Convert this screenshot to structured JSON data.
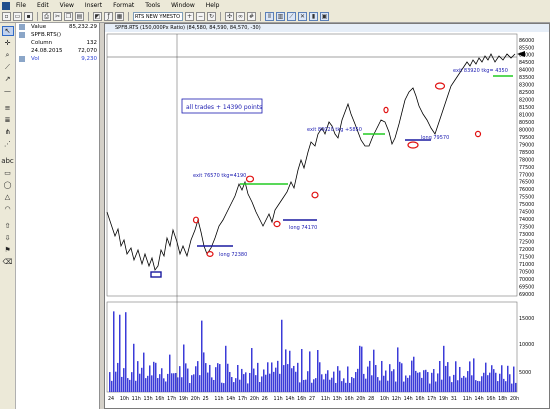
{
  "menu": [
    "File",
    "Edit",
    "View",
    "Insert",
    "Format",
    "Tools",
    "Window",
    "Help"
  ],
  "toolbar": {
    "symbol_select": "RTS NEW YMESTO CROSS",
    "chart_buttons": [
      "bar-chart-icon",
      "candle-chart-icon",
      "line-chart-icon"
    ]
  },
  "data_window": {
    "rows": [
      {
        "label": "Value",
        "value": "85,232.29"
      },
      {
        "label": "SPFB.RTS()",
        "value": ""
      },
      {
        "label": "Column",
        "value": "132"
      },
      {
        "label": "24.08.2015",
        "value": "72,070"
      },
      {
        "label": "Vol",
        "value": "9,230"
      }
    ]
  },
  "chart": {
    "title_bar": "SPFB.RTS (150,000Px Ratio)  (84,580, 84,590, 84,570, -30)",
    "note": "all trades + 14390 points",
    "annotations": {
      "exit1": "exit 76570 tkg=4190",
      "long1": "long 72380",
      "long2": "long 74170",
      "exit2": "exit 80020 tkg +5850",
      "long3": "long 79570",
      "exit3": "exit 83920 tkg= 4350"
    },
    "price_axis": [
      "86000",
      "85500",
      "85000",
      "84500",
      "84000",
      "83500",
      "83000",
      "82500",
      "82000",
      "81500",
      "81000",
      "80500",
      "80000",
      "79500",
      "79000",
      "78500",
      "78000",
      "77500",
      "77000",
      "76500",
      "76000",
      "75500",
      "75000",
      "74500",
      "74000",
      "73500",
      "73000",
      "72500",
      "72000",
      "71500",
      "71000",
      "70500",
      "70000",
      "69500",
      "69000"
    ],
    "volume_axis": [
      "15000",
      "10000",
      "5000"
    ],
    "time_axis": [
      "24",
      "10h",
      "11h",
      "13h",
      "16h",
      "17h",
      "19h",
      "20h",
      "25",
      "11h",
      "14h",
      "17h",
      "20h",
      "26",
      "11h",
      "14h",
      "16h",
      "27",
      "11h",
      "13h",
      "16h",
      "20h",
      "28",
      "10h",
      "12h",
      "14h",
      "16h",
      "17h",
      "19h",
      "31",
      "11h",
      "14h",
      "16h",
      "18h",
      "20h"
    ]
  },
  "colors": {
    "price_line": "#000000",
    "entry_level": "#1a1aa0",
    "exit_level": "#22cc22",
    "trade_marker": "#e01010",
    "note_text": "#1a1ab0",
    "volume_bar": "#3b3bd8",
    "last_price_marker": "#000000"
  }
}
